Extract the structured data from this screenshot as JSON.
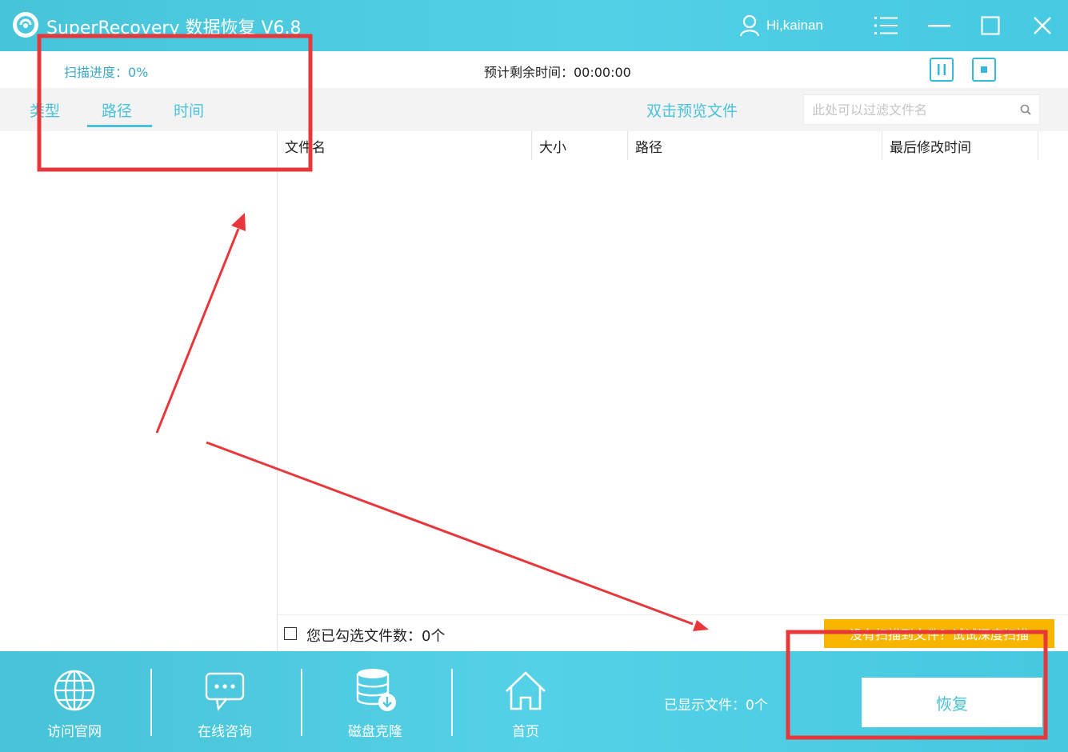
{
  "titlebar": {
    "app_title": "SuperRecovery 数据恢复 V6.8",
    "user_label": "Hi,kainan"
  },
  "status": {
    "scan_progress": "扫描进度：0%",
    "remaining_time": "预计剩余时间：00:00:00"
  },
  "tabs": [
    {
      "label": "类型"
    },
    {
      "label": "路径"
    },
    {
      "label": "时间"
    }
  ],
  "active_tab": "路径",
  "preview_hint": "双击预览文件",
  "search": {
    "placeholder": "此处可以过滤文件名"
  },
  "table": {
    "columns": [
      "文件名",
      "大小",
      "路径",
      "最后修改时间"
    ],
    "rows": []
  },
  "selection": {
    "count_text": "您已勾选文件数：0个"
  },
  "deep_scan_button": "没有扫描到文件？试试深度扫描",
  "bottom_nav": [
    {
      "label": "访问官网",
      "icon": "globe-icon"
    },
    {
      "label": "在线咨询",
      "icon": "chat-icon"
    },
    {
      "label": "磁盘克隆",
      "icon": "disk-clone-icon"
    },
    {
      "label": "首页",
      "icon": "home-icon"
    }
  ],
  "displayed_files": "已显示文件：0个",
  "recover_button": "恢复",
  "colors": {
    "accent": "#49c2d9",
    "titlebar": "#52d0e6",
    "warning_button": "#f7b500",
    "annotation_red": "#e8373b"
  }
}
